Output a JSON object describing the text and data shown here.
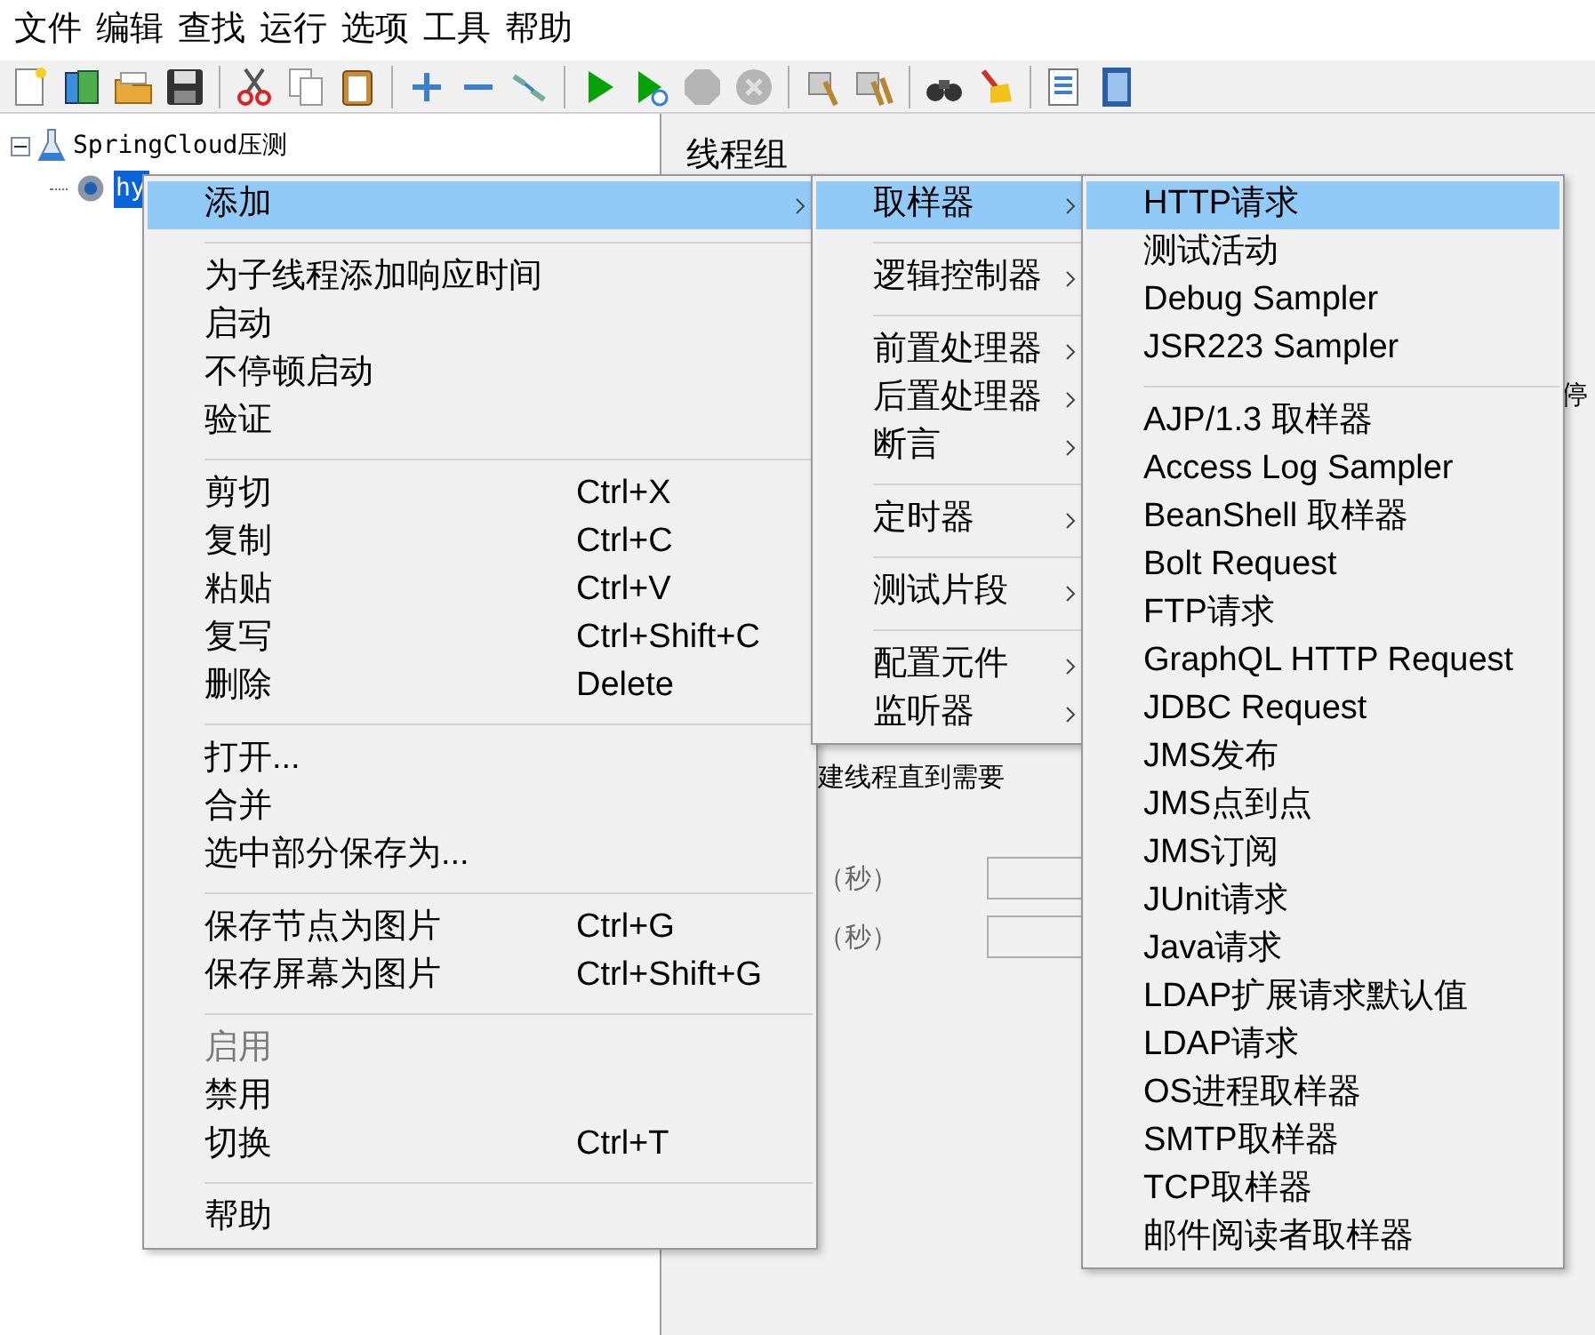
{
  "menubar": [
    "文件",
    "编辑",
    "查找",
    "运行",
    "选项",
    "工具",
    "帮助"
  ],
  "toolbar": [
    {
      "kind": "new"
    },
    {
      "kind": "templates"
    },
    {
      "kind": "open"
    },
    {
      "kind": "save"
    },
    {
      "kind": "sep"
    },
    {
      "kind": "cut"
    },
    {
      "kind": "copy"
    },
    {
      "kind": "paste"
    },
    {
      "kind": "sep"
    },
    {
      "kind": "expand"
    },
    {
      "kind": "collapse"
    },
    {
      "kind": "toggle"
    },
    {
      "kind": "sep"
    },
    {
      "kind": "start",
      "disabled": false
    },
    {
      "kind": "start-no-pause",
      "disabled": false
    },
    {
      "kind": "stop",
      "disabled": true
    },
    {
      "kind": "shutdown",
      "disabled": true
    },
    {
      "kind": "sep"
    },
    {
      "kind": "clear"
    },
    {
      "kind": "clear-all"
    },
    {
      "kind": "sep"
    },
    {
      "kind": "search"
    },
    {
      "kind": "reset"
    },
    {
      "kind": "sep"
    },
    {
      "kind": "functions"
    },
    {
      "kind": "help"
    }
  ],
  "tree": {
    "label": "SpringCloud压测",
    "expanded": true,
    "children": [
      {
        "label": "hy",
        "selected": true
      }
    ]
  },
  "panel": {
    "title": "线程组",
    "fragments": [
      {
        "kind": "text",
        "text": "停"
      },
      {
        "kind": "text",
        "text": "建线程直到需要"
      },
      {
        "kind": "label",
        "text": "（秒）"
      },
      {
        "kind": "label",
        "text": "（秒）"
      }
    ]
  },
  "context_menu": [
    {
      "kind": "item",
      "label": "添加",
      "submenu": true,
      "selected": true,
      "disabled": false
    },
    {
      "kind": "separator"
    },
    {
      "kind": "item",
      "label": "为子线程添加响应时间",
      "selected": false,
      "disabled": false
    },
    {
      "kind": "item",
      "label": "启动",
      "selected": false,
      "disabled": false
    },
    {
      "kind": "item",
      "label": "不停顿启动",
      "selected": false,
      "disabled": false
    },
    {
      "kind": "item",
      "label": "验证",
      "selected": false,
      "disabled": false
    },
    {
      "kind": "separator"
    },
    {
      "kind": "item",
      "label": "剪切",
      "shortcut": "Ctrl+X",
      "selected": false,
      "disabled": false
    },
    {
      "kind": "item",
      "label": "复制",
      "shortcut": "Ctrl+C",
      "selected": false,
      "disabled": false
    },
    {
      "kind": "item",
      "label": "粘贴",
      "shortcut": "Ctrl+V",
      "selected": false,
      "disabled": false
    },
    {
      "kind": "item",
      "label": "复写",
      "shortcut": "Ctrl+Shift+C",
      "selected": false,
      "disabled": false
    },
    {
      "kind": "item",
      "label": "删除",
      "shortcut": "Delete",
      "selected": false,
      "disabled": false
    },
    {
      "kind": "separator"
    },
    {
      "kind": "item",
      "label": "打开...",
      "selected": false,
      "disabled": false
    },
    {
      "kind": "item",
      "label": "合并",
      "selected": false,
      "disabled": false
    },
    {
      "kind": "item",
      "label": "选中部分保存为...",
      "selected": false,
      "disabled": false
    },
    {
      "kind": "separator"
    },
    {
      "kind": "item",
      "label": "保存节点为图片",
      "shortcut": "Ctrl+G",
      "selected": false,
      "disabled": false
    },
    {
      "kind": "item",
      "label": "保存屏幕为图片",
      "shortcut": "Ctrl+Shift+G",
      "selected": false,
      "disabled": false
    },
    {
      "kind": "separator"
    },
    {
      "kind": "item",
      "label": "启用",
      "selected": false,
      "disabled": true
    },
    {
      "kind": "item",
      "label": "禁用",
      "selected": false,
      "disabled": false
    },
    {
      "kind": "item",
      "label": "切换",
      "shortcut": "Ctrl+T",
      "selected": false,
      "disabled": false
    },
    {
      "kind": "separator"
    },
    {
      "kind": "item",
      "label": "帮助",
      "selected": false,
      "disabled": false
    }
  ],
  "add_submenu": [
    {
      "kind": "item",
      "label": "取样器",
      "submenu": true,
      "selected": true
    },
    {
      "kind": "separator"
    },
    {
      "kind": "item",
      "label": "逻辑控制器",
      "submenu": true,
      "selected": false
    },
    {
      "kind": "separator"
    },
    {
      "kind": "item",
      "label": "前置处理器",
      "submenu": true,
      "selected": false
    },
    {
      "kind": "item",
      "label": "后置处理器",
      "submenu": true,
      "selected": false
    },
    {
      "kind": "item",
      "label": "断言",
      "submenu": true,
      "selected": false
    },
    {
      "kind": "separator"
    },
    {
      "kind": "item",
      "label": "定时器",
      "submenu": true,
      "selected": false
    },
    {
      "kind": "separator"
    },
    {
      "kind": "item",
      "label": "测试片段",
      "submenu": true,
      "selected": false
    },
    {
      "kind": "separator"
    },
    {
      "kind": "item",
      "label": "配置元件",
      "submenu": true,
      "selected": false
    },
    {
      "kind": "item",
      "label": "监听器",
      "submenu": true,
      "selected": false
    }
  ],
  "sampler_submenu": [
    {
      "kind": "item",
      "label": "HTTP请求",
      "selected": true
    },
    {
      "kind": "item",
      "label": "测试活动",
      "selected": false
    },
    {
      "kind": "item",
      "label": "Debug Sampler",
      "selected": false
    },
    {
      "kind": "item",
      "label": "JSR223 Sampler",
      "selected": false
    },
    {
      "kind": "separator"
    },
    {
      "kind": "item",
      "label": "AJP/1.3 取样器",
      "selected": false
    },
    {
      "kind": "item",
      "label": "Access Log Sampler",
      "selected": false
    },
    {
      "kind": "item",
      "label": "BeanShell 取样器",
      "selected": false
    },
    {
      "kind": "item",
      "label": "Bolt Request",
      "selected": false
    },
    {
      "kind": "item",
      "label": "FTP请求",
      "selected": false
    },
    {
      "kind": "item",
      "label": "GraphQL HTTP Request",
      "selected": false
    },
    {
      "kind": "item",
      "label": "JDBC Request",
      "selected": false
    },
    {
      "kind": "item",
      "label": "JMS发布",
      "selected": false
    },
    {
      "kind": "item",
      "label": "JMS点到点",
      "selected": false
    },
    {
      "kind": "item",
      "label": "JMS订阅",
      "selected": false
    },
    {
      "kind": "item",
      "label": "JUnit请求",
      "selected": false
    },
    {
      "kind": "item",
      "label": "Java请求",
      "selected": false
    },
    {
      "kind": "item",
      "label": "LDAP扩展请求默认值",
      "selected": false
    },
    {
      "kind": "item",
      "label": "LDAP请求",
      "selected": false
    },
    {
      "kind": "item",
      "label": "OS进程取样器",
      "selected": false
    },
    {
      "kind": "item",
      "label": "SMTP取样器",
      "selected": false
    },
    {
      "kind": "item",
      "label": "TCP取样器",
      "selected": false
    },
    {
      "kind": "item",
      "label": "邮件阅读者取样器",
      "selected": false
    }
  ]
}
